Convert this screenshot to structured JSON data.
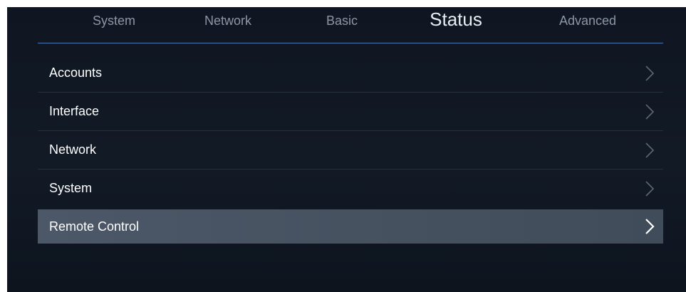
{
  "tabs": [
    {
      "label": "System",
      "active": false
    },
    {
      "label": "Network",
      "active": false
    },
    {
      "label": "Basic",
      "active": false
    },
    {
      "label": "Status",
      "active": true
    },
    {
      "label": "Advanced",
      "active": false
    }
  ],
  "menu": {
    "items": [
      {
        "label": "Accounts",
        "selected": false
      },
      {
        "label": "Interface",
        "selected": false
      },
      {
        "label": "Network",
        "selected": false
      },
      {
        "label": "System",
        "selected": false
      },
      {
        "label": "Remote Control",
        "selected": true
      }
    ]
  },
  "icons": {
    "chevron": "chevron-right-icon"
  },
  "colors": {
    "background": "#121a26",
    "accent_divider": "#4a78b0",
    "selected_row": "#465260",
    "inactive_tab": "#8d96a3",
    "active_tab": "#e9edf2",
    "chevron_dim": "#5d6673",
    "chevron_bright": "#ffffff"
  }
}
